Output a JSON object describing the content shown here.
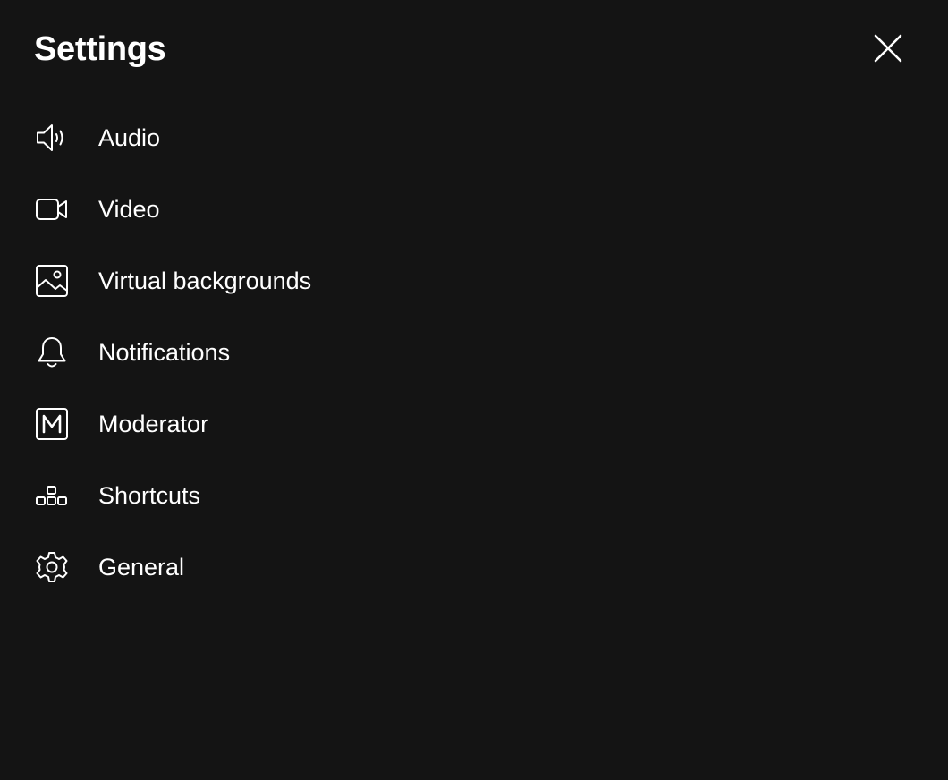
{
  "header": {
    "title": "Settings",
    "close_icon": "close-icon"
  },
  "menu": {
    "items": [
      {
        "label": "Audio",
        "icon": "speaker-icon"
      },
      {
        "label": "Video",
        "icon": "video-camera-icon"
      },
      {
        "label": "Virtual backgrounds",
        "icon": "image-icon"
      },
      {
        "label": "Notifications",
        "icon": "bell-icon"
      },
      {
        "label": "Moderator",
        "icon": "moderator-m-icon"
      },
      {
        "label": "Shortcuts",
        "icon": "shortcuts-icon"
      },
      {
        "label": "General",
        "icon": "gear-icon"
      }
    ]
  },
  "colors": {
    "background": "#141414",
    "text": "#ffffff"
  }
}
